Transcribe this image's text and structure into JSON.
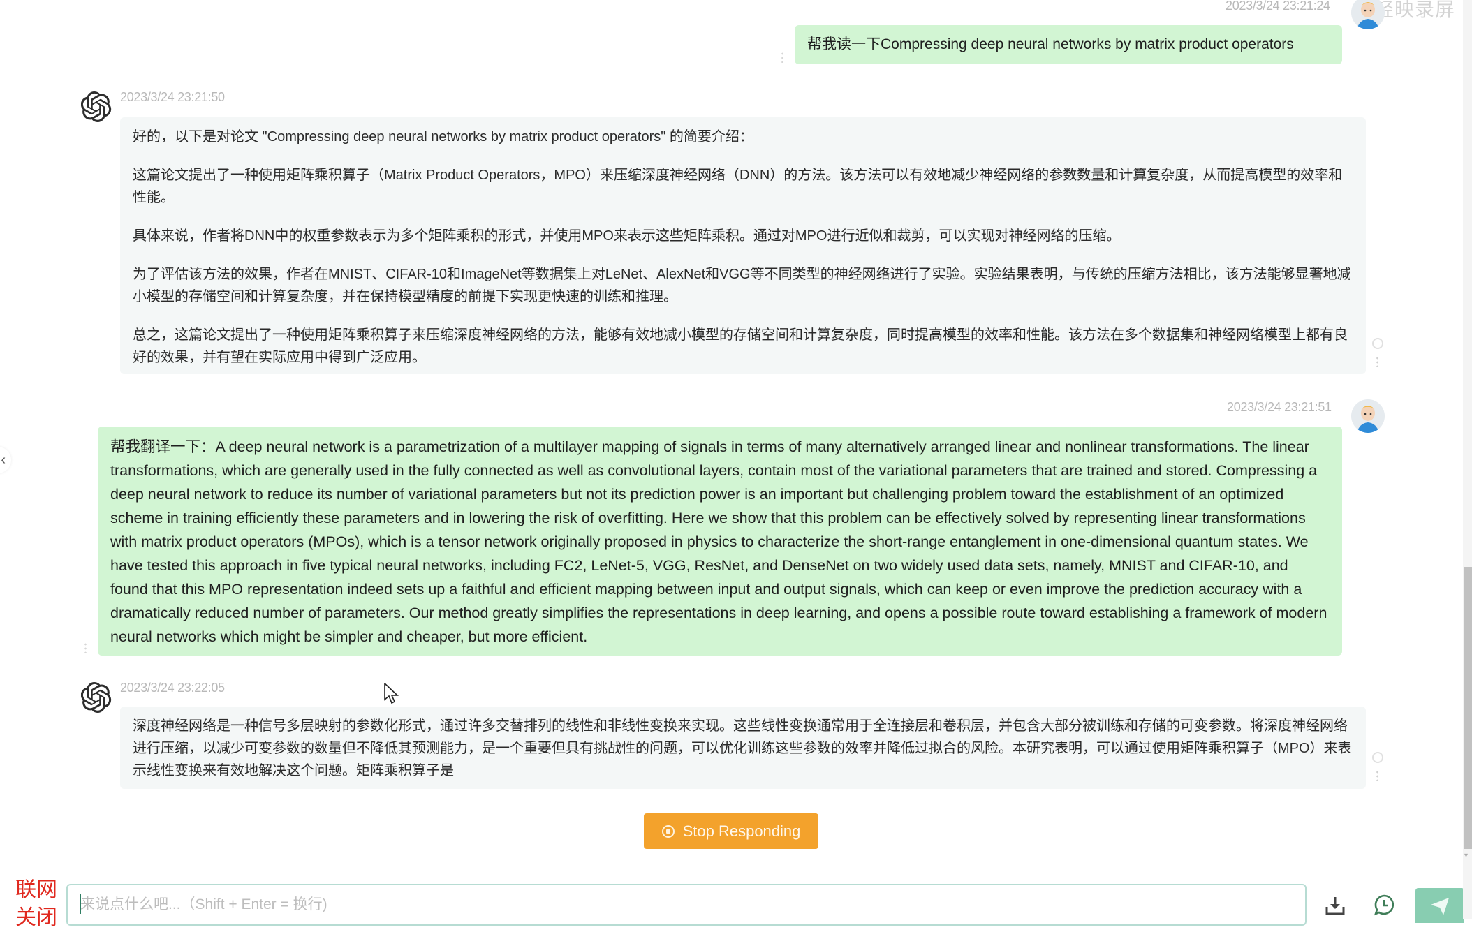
{
  "watermark": "轻映录屏",
  "messages": [
    {
      "role": "user",
      "timestamp": "2023/3/24 23:21:24",
      "text": "帮我读一下Compressing deep neural networks by matrix product operators"
    },
    {
      "role": "assistant",
      "timestamp": "2023/3/24 23:21:50",
      "paragraphs": [
        "好的，以下是对论文 \"Compressing deep neural networks by matrix product operators\" 的简要介绍：",
        "这篇论文提出了一种使用矩阵乘积算子（Matrix Product Operators，MPO）来压缩深度神经网络（DNN）的方法。该方法可以有效地减少神经网络的参数数量和计算复杂度，从而提高模型的效率和性能。",
        "具体来说，作者将DNN中的权重参数表示为多个矩阵乘积的形式，并使用MPO来表示这些矩阵乘积。通过对MPO进行近似和裁剪，可以实现对神经网络的压缩。",
        "为了评估该方法的效果，作者在MNIST、CIFAR-10和ImageNet等数据集上对LeNet、AlexNet和VGG等不同类型的神经网络进行了实验。实验结果表明，与传统的压缩方法相比，该方法能够显著地减小模型的存储空间和计算复杂度，并在保持模型精度的前提下实现更快速的训练和推理。",
        "总之，这篇论文提出了一种使用矩阵乘积算子来压缩深度神经网络的方法，能够有效地减小模型的存储空间和计算复杂度，同时提高模型的效率和性能。该方法在多个数据集和神经网络模型上都有良好的效果，并有望在实际应用中得到广泛应用。"
      ]
    },
    {
      "role": "user",
      "timestamp": "2023/3/24 23:21:51",
      "text": "帮我翻译一下：A deep neural network is a parametrization of a multilayer mapping of signals in terms of many alternatively arranged linear and nonlinear transformations. The linear transformations, which are generally used in the fully connected as well as convolutional layers, contain most of the variational parameters that are trained and stored. Compressing a deep neural network to reduce its number of variational parameters but not its prediction power is an important but challenging problem toward the establishment of an optimized scheme in training efficiently these parameters and in lowering the risk of overfitting. Here we show that this problem can be effectively solved by representing linear transformations with matrix product operators (MPOs), which is a tensor network originally proposed in physics to characterize the short-range entanglement in one-dimensional quantum states. We have tested this approach in five typical neural networks, including FC2, LeNet-5, VGG, ResNet, and DenseNet on two widely used data sets, namely, MNIST and CIFAR-10, and found that this MPO representation indeed sets up a faithful and efficient mapping between input and output signals, which can keep or even improve the prediction accuracy with a dramatically reduced number of parameters. Our method greatly simplifies the representations in deep learning, and opens a possible route toward establishing a framework of modern neural networks which might be simpler and cheaper, but more efficient."
    },
    {
      "role": "assistant",
      "timestamp": "2023/3/24 23:22:05",
      "paragraphs": [
        "深度神经网络是一种信号多层映射的参数化形式，通过许多交替排列的线性和非线性变换来实现。这些线性变换通常用于全连接层和卷积层，并包含大部分被训练和存储的可变参数。将深度神经网络进行压缩，以减少可变参数的数量但不降低其预测能力，是一个重要但具有挑战性的问题，可以优化训练这些参数的效率并降低过拟合的风险。本研究表明，可以通过使用矩阵乘积算子（MPO）来表示线性变换来有效地解决这个问题。矩阵乘积算子是"
      ]
    }
  ],
  "stop_button": {
    "label": "Stop Responding",
    "icon": "stop-circle-icon"
  },
  "network_toggle": {
    "label": "联网关闭",
    "color": "#e0281e"
  },
  "input": {
    "placeholder": "来说点什么吧...（Shift + Enter = 换行)",
    "value": ""
  },
  "toolbar": {
    "download_icon": "download-icon",
    "history_icon": "chat-history-icon",
    "send_icon": "send-icon"
  },
  "colors": {
    "user_bubble": "#d2f5d3",
    "assistant_bubble": "#f4f7f7",
    "stop_button": "#f3a22c",
    "send_button": "#88cdb1",
    "network_off": "#e0281e"
  }
}
